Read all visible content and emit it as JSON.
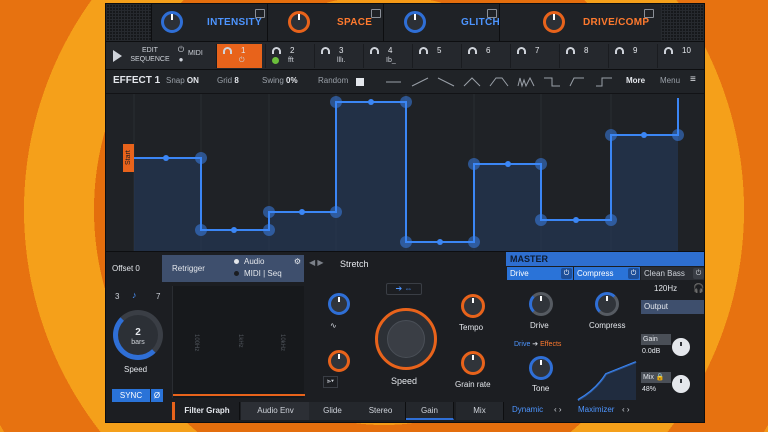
{
  "macros": [
    {
      "label": "INTENSITY",
      "color": "blue"
    },
    {
      "label": "SPACE",
      "color": "orange"
    },
    {
      "label": "GLITCH",
      "color": "blue"
    },
    {
      "label": "DRIVE/COMP",
      "color": "orange"
    }
  ],
  "sequencer": {
    "edit_label_1": "EDIT",
    "edit_label_2": "SEQUENCE",
    "midi_label": "MIDI",
    "slots": [
      {
        "num": "1",
        "sub": "⏻"
      },
      {
        "num": "2",
        "sub": "fft"
      },
      {
        "num": "3",
        "sub": "lllı."
      },
      {
        "num": "4",
        "sub": "Ib_"
      },
      {
        "num": "5",
        "sub": ""
      },
      {
        "num": "6",
        "sub": ""
      },
      {
        "num": "7",
        "sub": ""
      },
      {
        "num": "8",
        "sub": ""
      },
      {
        "num": "9",
        "sub": ""
      },
      {
        "num": "10",
        "sub": ""
      }
    ]
  },
  "effect": {
    "title": "EFFECT 1",
    "snap_label": "Snap",
    "snap_value": "ON",
    "grid_label": "Grid",
    "grid_value": "8",
    "swing_label": "Swing",
    "swing_value": "0%",
    "random_label": "Random",
    "more_label": "More",
    "menu_label": "Menu",
    "start_label": "Start"
  },
  "bottom": {
    "offset_label": "Offset 0",
    "retrigger_label": "Retrigger",
    "audio_label": "Audio",
    "midi_seq_label": "MIDI | Seq",
    "rate_left": "3",
    "rate_right": "7",
    "bars_value": "2",
    "bars_label": "bars",
    "speed_label": "Speed",
    "sync_label": "SYNC",
    "stretch_label": "Stretch",
    "tempo_label": "Tempo",
    "speed_big_label": "Speed",
    "grain_label": "Grain rate",
    "tabs": [
      "Filter Graph",
      "Audio Env",
      "Glide",
      "Stereo",
      "Gain",
      "Mix"
    ],
    "freq_labels": [
      "100Hz",
      "1kHz",
      "10kHz"
    ]
  },
  "master": {
    "title": "MASTER",
    "drive_btn": "Drive",
    "compress_btn": "Compress",
    "clean_btn": "Clean Bass",
    "drive_label": "Drive",
    "drive_effects_1": "Drive",
    "drive_effects_2": "Effects",
    "tone_label": "Tone",
    "compress_label": "Compress",
    "freq": "120Hz",
    "output_label": "Output",
    "gain_label": "Gain",
    "gain_value": "0.0dB",
    "mix_label": "Mix",
    "mix_value": "48%",
    "dynamic_label": "Dynamic",
    "maximizer_label": "Maximizer"
  },
  "colors": {
    "accent_blue": "#2f6fd6",
    "accent_orange": "#e8631b"
  }
}
